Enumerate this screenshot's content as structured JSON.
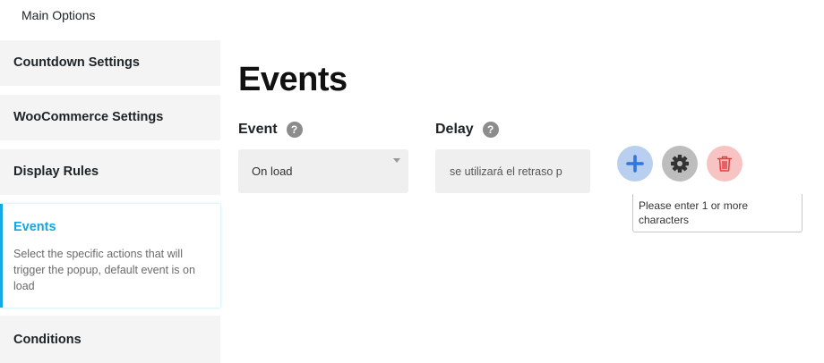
{
  "header": {
    "main_options": "Main Options"
  },
  "sidebar": {
    "items": [
      {
        "label": "Countdown Settings"
      },
      {
        "label": "WooCommerce Settings"
      },
      {
        "label": "Display Rules"
      },
      {
        "label": "Events",
        "description": "Select the specific actions that will trigger the popup, default event is on load",
        "active": true
      },
      {
        "label": "Conditions"
      }
    ]
  },
  "main": {
    "title": "Events",
    "event_field": {
      "label": "Event",
      "value": "On load"
    },
    "delay_field": {
      "label": "Delay",
      "placeholder": "se utilizará el retraso p"
    },
    "buttons": {
      "add": "plus-icon",
      "settings": "gear-icon",
      "delete": "trash-icon"
    },
    "tooltip": "Please enter 1 or more characters"
  },
  "colors": {
    "accent": "#16a8e6",
    "add_bg": "#b9cff0",
    "add_icon": "#2f77de",
    "delete_bg": "#f7c3c3",
    "delete_icon": "#e0413e"
  }
}
